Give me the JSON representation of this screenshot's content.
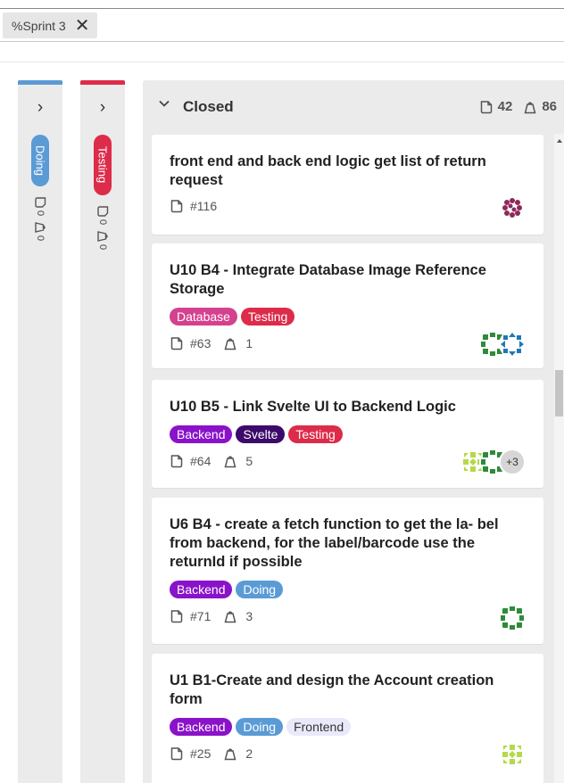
{
  "filter": {
    "chip_label": "%Sprint 3"
  },
  "columns_collapsed": [
    {
      "name": "Doing",
      "color": "#5b9bd5",
      "issue_count": "0",
      "weight": "0"
    },
    {
      "name": "Testing",
      "color": "#dd2b4a",
      "issue_count": "0",
      "weight": "0"
    }
  ],
  "closed_column": {
    "title": "Closed",
    "issue_count": "42",
    "weight_total": "86"
  },
  "cards": [
    {
      "title": "front end and back end logic get list of return request",
      "id": "#116",
      "weight": "",
      "labels": [],
      "avatars": [
        "purple"
      ]
    },
    {
      "title": "U10 B4 - Integrate Database Image Reference Storage",
      "id": "#63",
      "weight": "1",
      "labels": [
        "Database",
        "Testing"
      ],
      "avatars": [
        "green",
        "blue"
      ]
    },
    {
      "title": "U10 B5 - Link Svelte UI to Backend Logic",
      "id": "#64",
      "weight": "5",
      "labels": [
        "Backend",
        "Svelte",
        "Testing"
      ],
      "avatars": [
        "lime",
        "green"
      ],
      "more": "+3"
    },
    {
      "title": "U6 B4 - create a fetch function to get the la- bel from backend, for the label/barcode use the returnId if possible",
      "id": "#71",
      "weight": "3",
      "labels": [
        "Backend",
        "Doing"
      ],
      "avatars": [
        "green"
      ]
    },
    {
      "title": "U1 B1-Create and design the Account creation form",
      "id": "#25",
      "weight": "2",
      "labels": [
        "Backend",
        "Doing",
        "Frontend"
      ],
      "avatars": [
        "lime"
      ]
    }
  ],
  "label_colors": {
    "Database": "#d4418e",
    "Testing": "#dd2b4a",
    "Backend": "#8a12c9",
    "Svelte": "#3d0a6b",
    "Doing": "#5b9bd5",
    "Frontend": "#e9e9fb"
  },
  "icons": {
    "issue": "issue-icon",
    "weight": "weight-icon",
    "chevron_right": "chevron-right-icon",
    "chevron_down": "chevron-down-icon",
    "close": "close-icon"
  }
}
